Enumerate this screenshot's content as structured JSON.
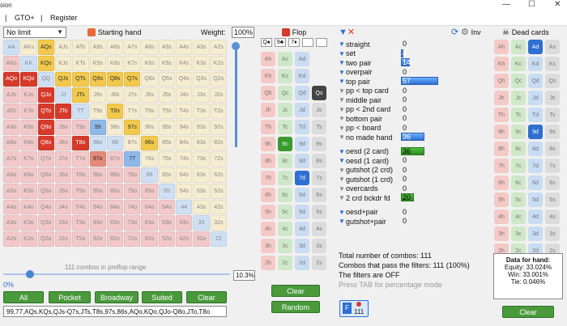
{
  "window": {
    "title": "sion",
    "minimize": "—",
    "maximize": "☐",
    "close": "✕"
  },
  "menu": {
    "sep": "|",
    "items": [
      "GTO+",
      "Register"
    ]
  },
  "left": {
    "limit": "No limit",
    "starting_hand_label": "Starting hand",
    "weight_label": "Weight:",
    "weight_value": "100%",
    "combos_label": "111 combos in preflop range",
    "pct_value": "10.3%",
    "slider_min": "0%",
    "slider_fraction": 0.103,
    "buttons": [
      "All",
      "Pocket",
      "Broadway",
      "Suited",
      "Clear"
    ],
    "range_text": "99,77,AQs,KQs,QJs-Q7s,JTs,T8s,97s,86s,AQo,KQo,QJo-Q8o,JTo,T8o",
    "hands": [
      [
        "AA",
        "AKs",
        "AQs",
        "AJs",
        "ATs",
        "A9s",
        "A8s",
        "A7s",
        "A6s",
        "A5s",
        "A4s",
        "A3s",
        "A2s"
      ],
      [
        "AKo",
        "KK",
        "KQs",
        "KJs",
        "KTs",
        "K9s",
        "K8s",
        "K7s",
        "K6s",
        "K5s",
        "K4s",
        "K3s",
        "K2s"
      ],
      [
        "AQo",
        "KQo",
        "QQ",
        "QJs",
        "QTs",
        "Q9s",
        "Q8s",
        "Q7s",
        "Q6s",
        "Q5s",
        "Q4s",
        "Q3s",
        "Q2s"
      ],
      [
        "AJo",
        "KJo",
        "QJo",
        "JJ",
        "JTs",
        "J9s",
        "J8s",
        "J7s",
        "J6s",
        "J5s",
        "J4s",
        "J3s",
        "J2s"
      ],
      [
        "ATo",
        "KTo",
        "QTo",
        "JTo",
        "TT",
        "T9s",
        "T8s",
        "T7s",
        "T6s",
        "T5s",
        "T4s",
        "T3s",
        "T2s"
      ],
      [
        "A9o",
        "K9o",
        "Q9o",
        "J9o",
        "T9o",
        "99",
        "98s",
        "97s",
        "96s",
        "95s",
        "94s",
        "93s",
        "92s"
      ],
      [
        "A8o",
        "K8o",
        "Q8o",
        "J8o",
        "T8o",
        "98o",
        "88",
        "87s",
        "86s",
        "85s",
        "84s",
        "83s",
        "82s"
      ],
      [
        "A7o",
        "K7o",
        "Q7o",
        "J7o",
        "T7o",
        "97o",
        "87o",
        "77",
        "76s",
        "75s",
        "74s",
        "73s",
        "72s"
      ],
      [
        "A6o",
        "K6o",
        "Q6o",
        "J6o",
        "T6o",
        "96o",
        "86o",
        "76o",
        "66",
        "65s",
        "64s",
        "63s",
        "62s"
      ],
      [
        "A5o",
        "K5o",
        "Q5o",
        "J5o",
        "T5o",
        "95o",
        "85o",
        "75o",
        "65o",
        "55",
        "54s",
        "53s",
        "52s"
      ],
      [
        "A4o",
        "K4o",
        "Q4o",
        "J4o",
        "T4o",
        "94o",
        "84o",
        "74o",
        "64o",
        "54o",
        "44",
        "43s",
        "42s"
      ],
      [
        "A3o",
        "K3o",
        "Q3o",
        "J3o",
        "T3o",
        "93o",
        "83o",
        "73o",
        "63o",
        "53o",
        "43o",
        "33",
        "32s"
      ],
      [
        "A2o",
        "K2o",
        "Q2o",
        "J2o",
        "T2o",
        "92o",
        "82o",
        "72o",
        "62o",
        "52o",
        "42o",
        "32o",
        "22"
      ]
    ]
  },
  "flop": {
    "label": "Flop",
    "board": [
      "Q♠",
      "9♣",
      "7♦",
      "",
      ""
    ],
    "cards": [
      [
        "Ah",
        "Ac",
        "Ad"
      ],
      [
        "Kh",
        "Kc",
        "Kd"
      ],
      [
        "Qh",
        "Qc",
        "Qd",
        "Qs"
      ],
      [
        "Jh",
        "Jc",
        "Jd",
        "Js"
      ],
      [
        "Th",
        "Tc",
        "Td",
        "Ts"
      ],
      [
        "9h",
        "9c",
        "9d",
        "9s"
      ],
      [
        "8h",
        "8c",
        "8d",
        "8s"
      ],
      [
        "7h",
        "7c",
        "7d",
        "7s"
      ],
      [
        "6h",
        "6c",
        "6d",
        "6s"
      ],
      [
        "5h",
        "5c",
        "5d",
        "5s"
      ],
      [
        "4h",
        "4c",
        "4d",
        "4s"
      ],
      [
        "3h",
        "3c",
        "3d",
        "3s"
      ],
      [
        "2h",
        "2c",
        "2d",
        "2s"
      ]
    ],
    "clear": "Clear",
    "random": "Random"
  },
  "filters": {
    "made": [
      {
        "label": "straight",
        "n": 0,
        "type": "b"
      },
      {
        "label": "set",
        "n": 4,
        "type": "b"
      },
      {
        "label": "two pair",
        "n": 14,
        "type": "b"
      },
      {
        "label": "overpair",
        "n": 0,
        "type": "b"
      },
      {
        "label": "top pair",
        "n": 57,
        "type": "b"
      },
      {
        "label": "pp < top card",
        "n": 0,
        "type": "g"
      },
      {
        "label": "middle pair",
        "n": 0,
        "type": "g"
      },
      {
        "label": "pp < 2nd card",
        "n": 0,
        "type": "g"
      },
      {
        "label": "bottom pair",
        "n": 0,
        "type": "g"
      },
      {
        "label": "pp < board",
        "n": 0,
        "type": "g"
      },
      {
        "label": "no made hand",
        "n": 36,
        "type": "g"
      }
    ],
    "draws": [
      {
        "label": "oesd (2 card)",
        "n": 36,
        "type": "b"
      },
      {
        "label": "oesd (1 card)",
        "n": 0,
        "type": "b"
      },
      {
        "label": "gutshot (2 crd)",
        "n": 0,
        "type": "g"
      },
      {
        "label": "gutshot (1 crd)",
        "n": 0,
        "type": "g"
      },
      {
        "label": "overcards",
        "n": 0,
        "type": "g"
      },
      {
        "label": "2 crd bckdr fd",
        "n": 20,
        "type": "g"
      }
    ],
    "combo": [
      {
        "label": "oesd+pair",
        "n": 0,
        "type": "b"
      },
      {
        "label": "gutshot+pair",
        "n": 0,
        "type": "b"
      }
    ],
    "total": "Total number of combos: 111",
    "pass": "Combos that pass the filters: 111 (100%)",
    "state": "The filters are OFF",
    "hint": "Press TAB for percentage mode",
    "badge": "111",
    "inv": "Inv"
  },
  "dead": {
    "label": "Dead cards",
    "cards": [
      [
        "Ah",
        "Ac",
        "Ad",
        "As"
      ],
      [
        "Kh",
        "Kc",
        "Kd",
        "Ks"
      ],
      [
        "Qh",
        "Qc",
        "Qd",
        "Qs"
      ],
      [
        "Jh",
        "Jc",
        "Jd",
        "Js"
      ],
      [
        "Th",
        "Tc",
        "Td",
        "Ts"
      ],
      [
        "9h",
        "9c",
        "9d",
        "9s"
      ],
      [
        "8h",
        "8c",
        "8d",
        "8s"
      ],
      [
        "7h",
        "7c",
        "7d",
        "7s"
      ],
      [
        "6h",
        "6c",
        "6d",
        "6s"
      ],
      [
        "5h",
        "5c",
        "5d",
        "5s"
      ],
      [
        "4h",
        "4c",
        "4d",
        "4s"
      ],
      [
        "3h",
        "3c",
        "3d",
        "3s"
      ],
      [
        "2h",
        "2c",
        "2d",
        "2s"
      ]
    ],
    "data_title": "Data for hand:",
    "equity": "Equity: 33.024%",
    "win": "Win: 33.001%",
    "tie": "Tie: 0.046%",
    "clear": "Clear"
  },
  "colors": {
    "accent": "#2e6fd1",
    "green": "#4a9a3c",
    "red": "#d63a2a",
    "gold": "#f2c94c"
  }
}
